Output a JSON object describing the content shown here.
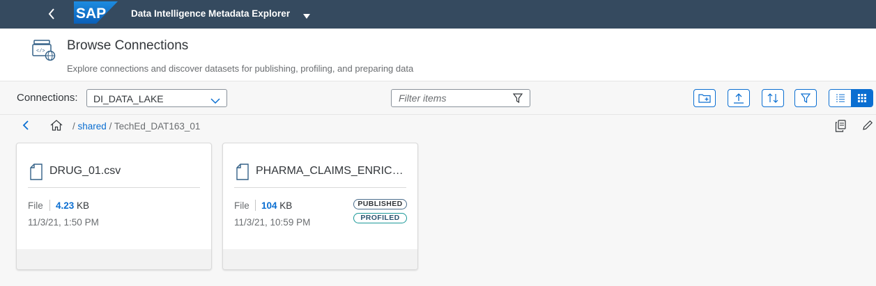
{
  "shell": {
    "app_title": "Data Intelligence Metadata Explorer",
    "logo_text": "SAP"
  },
  "header": {
    "title": "Browse Connections",
    "subtitle": "Explore connections and discover datasets for publishing, profiling, and preparing data"
  },
  "toolbar": {
    "connections_label": "Connections:",
    "connection_value": "DI_DATA_LAKE",
    "filter_placeholder": "Filter items"
  },
  "breadcrumb": {
    "separator1": "/",
    "shared": "shared",
    "separator2": "/",
    "current": "TechEd_DAT163_01"
  },
  "cards": [
    {
      "name": "DRUG_01.csv",
      "type": "File",
      "size_value": "4.23",
      "size_unit": "KB",
      "date": "11/3/21, 1:50 PM"
    },
    {
      "name": "PHARMA_CLAIMS_ENRICH...",
      "type": "File",
      "size_value": "104",
      "size_unit": "KB",
      "date": "11/3/21, 10:59 PM",
      "badges": [
        "PUBLISHED",
        "PROFILED"
      ]
    }
  ],
  "colors": {
    "shell": "#354a5f",
    "accent": "#0a6ed1",
    "sap_blue": "#0a6ed1"
  }
}
